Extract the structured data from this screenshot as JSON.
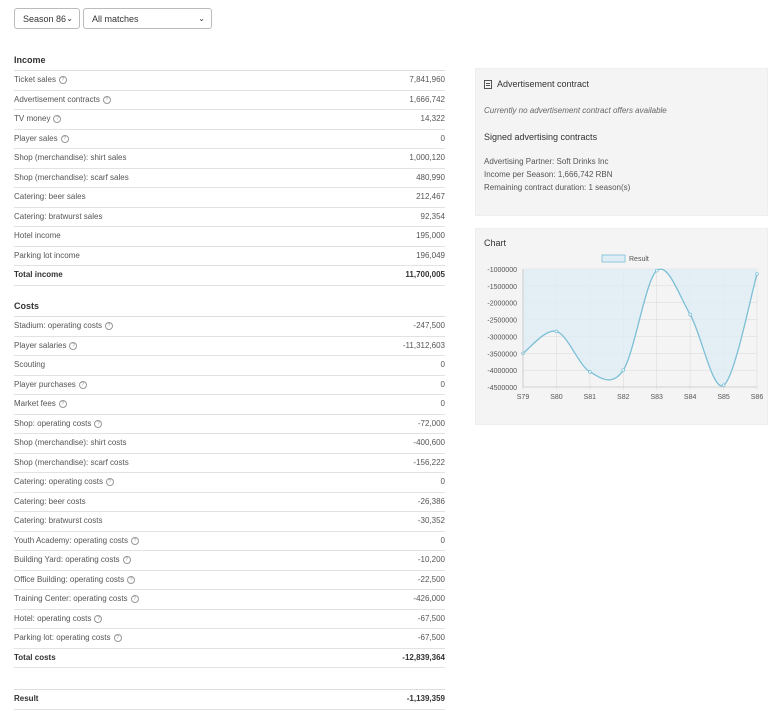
{
  "filters": {
    "season": "Season 86",
    "matches": "All matches"
  },
  "income": {
    "title": "Income",
    "rows": [
      {
        "label": "Ticket sales",
        "help": true,
        "value": "7,841,960"
      },
      {
        "label": "Advertisement contracts",
        "help": true,
        "value": "1,666,742"
      },
      {
        "label": "TV money",
        "help": true,
        "value": "14,322"
      },
      {
        "label": "Player sales",
        "help": true,
        "value": "0"
      },
      {
        "label": "Shop (merchandise): shirt sales",
        "help": false,
        "value": "1,000,120"
      },
      {
        "label": "Shop (merchandise): scarf sales",
        "help": false,
        "value": "480,990"
      },
      {
        "label": "Catering: beer sales",
        "help": false,
        "value": "212,467"
      },
      {
        "label": "Catering: bratwurst sales",
        "help": false,
        "value": "92,354"
      },
      {
        "label": "Hotel income",
        "help": false,
        "value": "195,000"
      },
      {
        "label": "Parking lot income",
        "help": false,
        "value": "196,049"
      }
    ],
    "total": {
      "label": "Total income",
      "value": "11,700,005"
    }
  },
  "costs": {
    "title": "Costs",
    "rows": [
      {
        "label": "Stadium: operating costs",
        "help": true,
        "value": "-247,500"
      },
      {
        "label": "Player salaries",
        "help": true,
        "value": "-11,312,603"
      },
      {
        "label": "Scouting",
        "help": false,
        "value": "0"
      },
      {
        "label": "Player purchases",
        "help": true,
        "value": "0"
      },
      {
        "label": "Market fees",
        "help": true,
        "value": "0"
      },
      {
        "label": "Shop: operating costs",
        "help": true,
        "value": "-72,000"
      },
      {
        "label": "Shop (merchandise): shirt costs",
        "help": false,
        "value": "-400,600"
      },
      {
        "label": "Shop (merchandise): scarf costs",
        "help": false,
        "value": "-156,222"
      },
      {
        "label": "Catering: operating costs",
        "help": true,
        "value": "0"
      },
      {
        "label": "Catering: beer costs",
        "help": false,
        "value": "-26,386"
      },
      {
        "label": "Catering: bratwurst costs",
        "help": false,
        "value": "-30,352"
      },
      {
        "label": "Youth Academy: operating costs",
        "help": true,
        "value": "0"
      },
      {
        "label": "Building Yard: operating costs",
        "help": true,
        "value": "-10,200"
      },
      {
        "label": "Office Building: operating costs",
        "help": true,
        "value": "-22,500"
      },
      {
        "label": "Training Center: operating costs",
        "help": true,
        "value": "-426,000"
      },
      {
        "label": "Hotel: operating costs",
        "help": true,
        "value": "-67,500"
      },
      {
        "label": "Parking lot: operating costs",
        "help": true,
        "value": "-67,500"
      }
    ],
    "total": {
      "label": "Total costs",
      "value": "-12,839,364"
    }
  },
  "result": {
    "label": "Result",
    "value": "-1,139,359"
  },
  "advertisement": {
    "title": "Advertisement contract",
    "no_offers": "Currently no advertisement contract offers available",
    "signed_title": "Signed advertising contracts",
    "lines": [
      "Advertising Partner: Soft Drinks Inc",
      "Income per Season: 1,666,742 RBN",
      "Remaining contract duration: 1 season(s)"
    ]
  },
  "chart_section": {
    "title": "Chart"
  },
  "chart_data": {
    "type": "line",
    "categories": [
      "S79",
      "S80",
      "S81",
      "S82",
      "S83",
      "S84",
      "S85",
      "S86"
    ],
    "series": [
      {
        "name": "Result",
        "values": [
          -3500000,
          -2850000,
          -4050000,
          -4000000,
          -1050000,
          -2350000,
          -4450000,
          -1150000
        ]
      }
    ],
    "ylim": [
      -4500000,
      -1000000
    ],
    "yticks": [
      -1000000,
      -1500000,
      -2000000,
      -2500000,
      -3000000,
      -3500000,
      -4000000,
      -4500000
    ],
    "legend": "top-center",
    "grid": true,
    "fill": "above",
    "line_color": "#7cbfd6",
    "fill_color": "#deeef4"
  }
}
